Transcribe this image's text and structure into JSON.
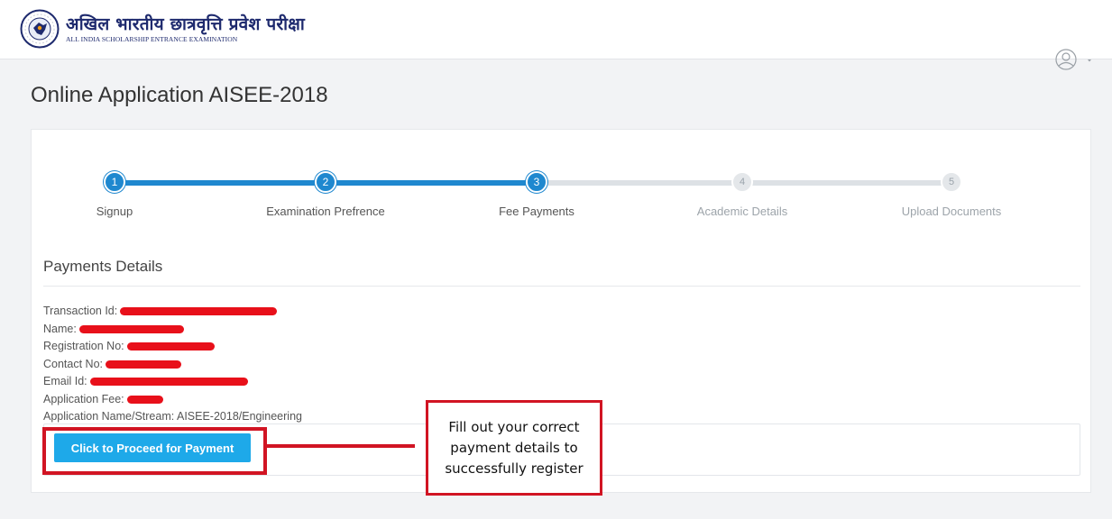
{
  "header": {
    "brand_hindi": "अखिल भारतीय छात्रवृत्ति प्रवेश परीक्षा",
    "brand_english": "ALL INDIA SCHOLARSHIP ENTRANCE EXAMINATION",
    "logo_icon": "emblem-logo-icon",
    "user_icon": "user-circle-icon",
    "user_menu_icon": "caret-down-icon"
  },
  "page": {
    "title": "Online Application AISEE-2018"
  },
  "stepper": {
    "steps": [
      {
        "number": "1",
        "label": "Signup",
        "status": "done"
      },
      {
        "number": "2",
        "label": "Examination Prefrence",
        "status": "done"
      },
      {
        "number": "3",
        "label": "Fee Payments",
        "status": "current"
      },
      {
        "number": "4",
        "label": "Academic Details",
        "status": "todo"
      },
      {
        "number": "5",
        "label": "Upload Documents",
        "status": "todo"
      }
    ],
    "accent_color": "#1f88cf"
  },
  "payment": {
    "section_title": "Payments Details",
    "fields": {
      "transaction_id": "Transaction Id:",
      "name": "Name:",
      "registration_no": "Registration No:",
      "contact_no": "Contact No:",
      "email_id": "Email Id:",
      "application_fee": "Application Fee:",
      "application_name": "Application Name/Stream: AISEE-2018/Engineering"
    },
    "redaction_color": "#e8101a",
    "proceed_button": "Click to Proceed for Payment"
  },
  "annotation": {
    "callout_line1": "Fill out your correct",
    "callout_line2": "payment details to",
    "callout_line3": "successfully register",
    "highlight_color": "#d11423"
  }
}
